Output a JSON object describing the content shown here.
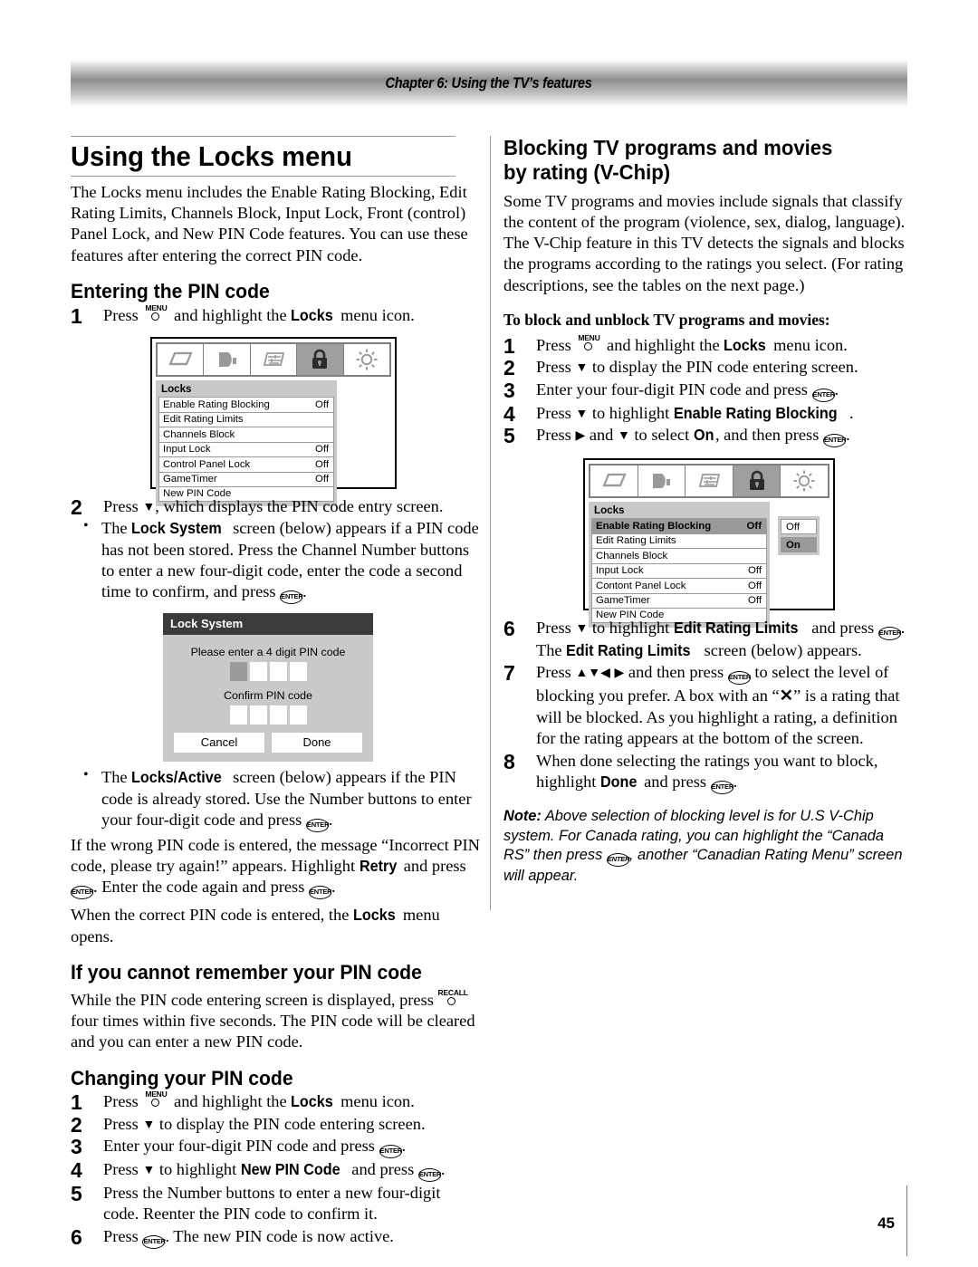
{
  "header": {
    "chapter": "Chapter 6: Using the TV’s features"
  },
  "page": {
    "number": "45"
  },
  "left": {
    "title": "Using the Locks menu",
    "intro": "The Locks menu includes the Enable Rating Blocking, Edit Rating Limits, Channels Block, Input Lock, Front (control) Panel Lock, and New PIN Code features. You can use these features after entering the correct PIN code.",
    "h_entering": "Entering the PIN code",
    "step1_a": "Press ",
    "step1_b": " and highlight the ",
    "step1_locks": "Locks",
    "step1_c": " menu icon.",
    "step2_a": "Press ",
    "step2_b": ", which displays the PIN code entry screen.",
    "bullet1_a": "The ",
    "bullet1_bold": "Lock System",
    "bullet1_b": " screen (below) appears if a PIN code has not been stored. Press the Channel Number buttons to enter a new four-digit code, enter the code a second time to confirm, and press ",
    "bullet1_c": ".",
    "bullet2_a": "The ",
    "bullet2_bold": "Locks/Active",
    "bullet2_b": " screen (below) appears if the PIN code is already stored. Use the Number buttons to enter your four-digit code and press ",
    "bullet2_c": ".",
    "para_wrong_a": "If the wrong PIN code is entered, the message “Incorrect PIN code, please try again!” appears. Highlight ",
    "para_wrong_retry": "Retry",
    "para_wrong_b": " and press ",
    "para_wrong_c": ". Enter the code again and press ",
    "para_wrong_d": ".",
    "para_correct_a": "When the correct PIN code is entered, the ",
    "para_correct_locks": "Locks",
    "para_correct_b": " menu opens.",
    "h_forgot": "If you cannot remember your PIN code",
    "forgot_a": "While the PIN code entering screen is displayed, press ",
    "forgot_b": " four times within five seconds. The PIN code will be cleared and you can enter a new PIN code.",
    "h_changing": "Changing your PIN code",
    "c1_a": "Press ",
    "c1_b": " and highlight the ",
    "c1_bold": "Locks",
    "c1_c": " menu icon.",
    "c2_a": "Press ",
    "c2_b": " to display the PIN code entering screen.",
    "c3_a": "Enter your four-digit PIN code and press ",
    "c3_b": ".",
    "c4_a": "Press ",
    "c4_b": " to highlight ",
    "c4_bold": "New PIN Code",
    "c4_c": " and press ",
    "c4_d": ".",
    "c5": "Press the Number buttons to enter a new four-digit code. Reenter the PIN code to confirm it.",
    "c6_a": "Press ",
    "c6_b": ". The new PIN code is now active."
  },
  "right": {
    "title_line1": "Blocking TV programs and movies",
    "title_line2": "by rating (V-Chip)",
    "intro": "Some TV programs and movies include signals that classify the content of the program (violence, sex, dialog, language). The V-Chip feature in this TV detects the signals and blocks the programs according to the ratings you select. (For rating descriptions, see the tables on the next page.)",
    "lead": "To block and unblock TV programs and movies:",
    "r1_a": "Press ",
    "r1_b": " and highlight the ",
    "r1_bold": "Locks",
    "r1_c": " menu icon.",
    "r2_a": "Press ",
    "r2_b": " to display the PIN code entering screen.",
    "r3_a": "Enter your four-digit PIN code and press ",
    "r3_b": ".",
    "r4_a": "Press ",
    "r4_b": " to highlight ",
    "r4_bold": "Enable Rating Blocking",
    "r4_c": ".",
    "r5_a": "Press ",
    "r5_b": " and ",
    "r5_c": " to select ",
    "r5_bold": "On",
    "r5_d": ", and then press ",
    "r5_e": ".",
    "r6_a": "Press ",
    "r6_b": " to highlight ",
    "r6_bold1": "Edit Rating Limits",
    "r6_c": " and press ",
    "r6_d": ". The ",
    "r6_bold2": "Edit Rating Limits",
    "r6_e": " screen (below) appears.",
    "r7_a": "Press ",
    "r7_b": " and then press ",
    "r7_c": " to select the level of blocking you prefer. A box with an “",
    "r7_x": "✕",
    "r7_d": "” is a rating that will be blocked. As you highlight a rating, a definition for the rating appears at the bottom of the screen.",
    "r8_a": "When done selecting the ratings you want to block, highlight ",
    "r8_bold": "Done",
    "r8_b": " and press ",
    "r8_c": ".",
    "note_label": "Note:",
    "note_a": " Above selection of blocking level is for U.S V-Chip system. For Canada rating, you can highlight the “Canada RS” then press ",
    "note_b": ", another “Canadian Rating Menu” screen will appear."
  },
  "keys": {
    "enter": "ENTER",
    "menu": "MENU",
    "recall": "RECALL",
    "down": "▼",
    "up": "▲",
    "left": "◀",
    "right": "▶"
  },
  "menu_graphic_1": {
    "icons": [
      "picture-icon",
      "audio-icon",
      "settings-icon",
      "lock-icon",
      "setup-icon"
    ],
    "selected_icon_index": 3,
    "panel_title": "Locks",
    "rows": [
      {
        "label": "Enable Rating Blocking",
        "value": "Off",
        "highlighted": false
      },
      {
        "label": "Edit Rating Limits",
        "value": "",
        "highlighted": false
      },
      {
        "label": "Channels Block",
        "value": "",
        "highlighted": false
      },
      {
        "label": "Input Lock",
        "value": "Off",
        "highlighted": false
      },
      {
        "label": "Control Panel Lock",
        "value": "Off",
        "highlighted": false
      },
      {
        "label": "GameTimer",
        "value": "Off",
        "highlighted": false
      },
      {
        "label": "New PIN Code",
        "value": "",
        "highlighted": false
      }
    ]
  },
  "menu_graphic_2": {
    "icons": [
      "picture-icon",
      "audio-icon",
      "settings-icon",
      "lock-icon",
      "setup-icon"
    ],
    "selected_icon_index": 3,
    "panel_title": "Locks",
    "rows": [
      {
        "label": "Enable Rating Blocking",
        "value": "Off",
        "highlighted": true
      },
      {
        "label": "Edit Rating Limits",
        "value": "",
        "highlighted": false
      },
      {
        "label": "Channels Block",
        "value": "",
        "highlighted": false
      },
      {
        "label": "Input Lock",
        "value": "Off",
        "highlighted": false
      },
      {
        "label": "Contont Panel Lock",
        "value": "Off",
        "highlighted": false
      },
      {
        "label": "GameTimer",
        "value": "Off",
        "highlighted": false
      },
      {
        "label": "New PIN Code",
        "value": "",
        "highlighted": false
      }
    ],
    "dropdown": [
      {
        "label": "Off",
        "selected": false
      },
      {
        "label": "On",
        "selected": true
      }
    ]
  },
  "lock_system_dialog": {
    "title": "Lock System",
    "prompt1": "Please enter a 4 digit PIN code",
    "prompt2": "Confirm PIN code",
    "cancel": "Cancel",
    "done": "Done"
  }
}
